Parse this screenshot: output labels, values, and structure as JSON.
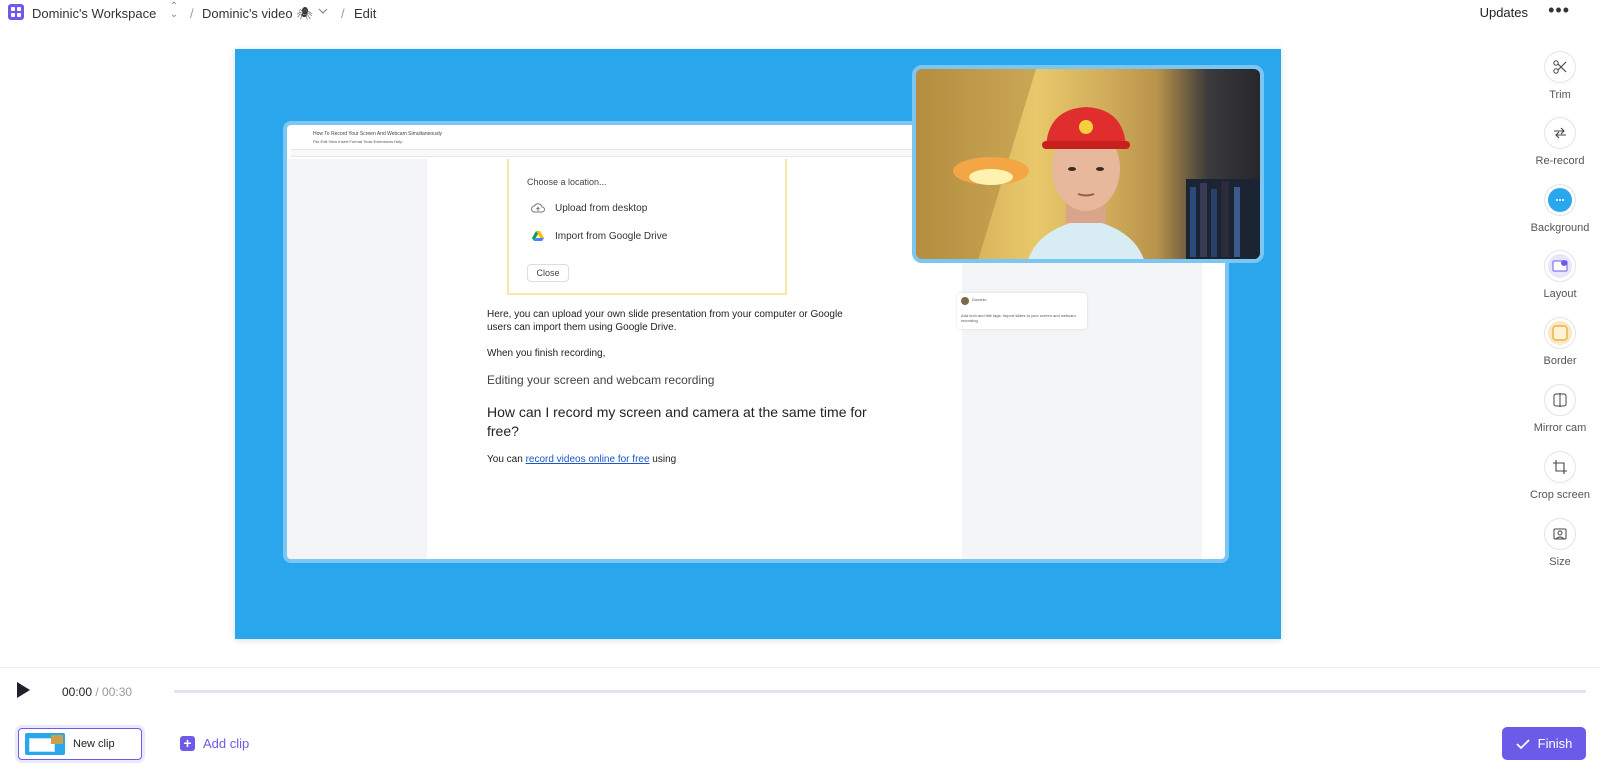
{
  "topbar": {
    "workspace": "Dominic's Workspace",
    "separator": "/",
    "video": "Dominic's video",
    "video_emoji": "🕷",
    "edit": "Edit",
    "updates": "Updates",
    "more": "•••"
  },
  "doc": {
    "title": "How To Record Your Screen And Webcam Simultaneously",
    "menu": "File   Edit   View   Insert   Format   Tools   Extensions   Help",
    "dialog": {
      "choose": "Choose a location...",
      "upload": "Upload from desktop",
      "drive": "Import from Google Drive",
      "close": "Close"
    },
    "p1": "Here, you can upload your own slide presentation from your computer or Google users can import them using Google Drive.",
    "p2": "When you finish recording,",
    "h2": "Editing your screen and webcam recording",
    "h1": "How can I record my screen and camera at the same time for free?",
    "p3_prefix": "You can ",
    "p3_link": "record videos online for free",
    "p3_suffix": " using",
    "comment_text": "Add tech and title tags: Import slides to your screen and webcam recording"
  },
  "tools": [
    {
      "label": "Trim",
      "icon": "scissors-icon"
    },
    {
      "label": "Re-record",
      "icon": "rerecord-icon"
    },
    {
      "label": "Background",
      "icon": "background-icon"
    },
    {
      "label": "Layout",
      "icon": "layout-icon"
    },
    {
      "label": "Border",
      "icon": "border-icon"
    },
    {
      "label": "Mirror cam",
      "icon": "mirror-icon"
    },
    {
      "label": "Crop screen",
      "icon": "crop-icon"
    },
    {
      "label": "Size",
      "icon": "size-icon"
    }
  ],
  "player": {
    "current": "00:00",
    "total": " / 00:30",
    "progress": 0
  },
  "bottom": {
    "clip_label": "New clip",
    "add_clip": "Add clip",
    "finish": "Finish"
  },
  "colors": {
    "accent": "#6b5be8",
    "canvas_bg": "#2aa6ec"
  }
}
